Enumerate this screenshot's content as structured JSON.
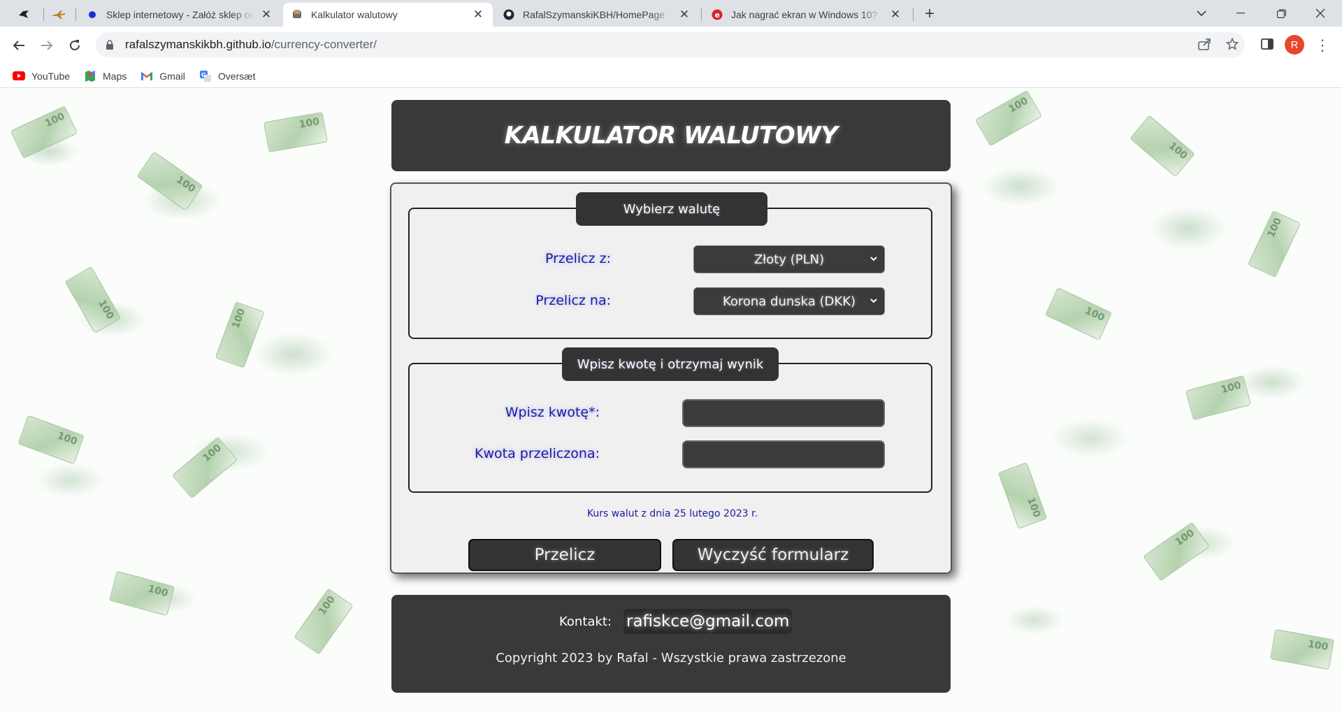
{
  "browser": {
    "tabs": [
      {
        "title": "Sklep internetowy - Załóż sklep online"
      },
      {
        "title": "Kalkulator walutowy"
      },
      {
        "title": "RafalSzymanskiKBH/HomePage"
      },
      {
        "title": "Jak nagrać ekran w Windows 10?"
      }
    ],
    "url_host": "rafalszymanskikbh.github.io",
    "url_path": "/currency-converter/",
    "profile_initial": "R",
    "bookmarks": [
      {
        "label": "YouTube",
        "icon": "youtube-icon"
      },
      {
        "label": "Maps",
        "icon": "maps-icon"
      },
      {
        "label": "Gmail",
        "icon": "gmail-icon"
      },
      {
        "label": "Oversæt",
        "icon": "translate-icon"
      }
    ]
  },
  "page": {
    "title": "KALKULATOR WALUTOWY",
    "currency_section": {
      "legend": "Wybierz walutę",
      "from_label": "Przelicz z:",
      "from_value": "Złoty (PLN)",
      "to_label": "Przelicz na:",
      "to_value": "Korona dunska (DKK)"
    },
    "amount_section": {
      "legend": "Wpisz kwotę i otrzymaj wynik",
      "amount_label": "Wpisz kwotę*:",
      "result_label": "Kwota przeliczona:"
    },
    "rate_note": "Kurs walut z dnia 25 lutego 2023 r.",
    "buttons": {
      "convert": "Przelicz",
      "clear": "Wyczyść formularz"
    },
    "footer": {
      "contact_label": "Kontakt:",
      "contact_email": "rafiskce@gmail.com",
      "copyright": "Copyright 2023 by Rafal - Wszystkie prawa zastrzezone"
    }
  }
}
